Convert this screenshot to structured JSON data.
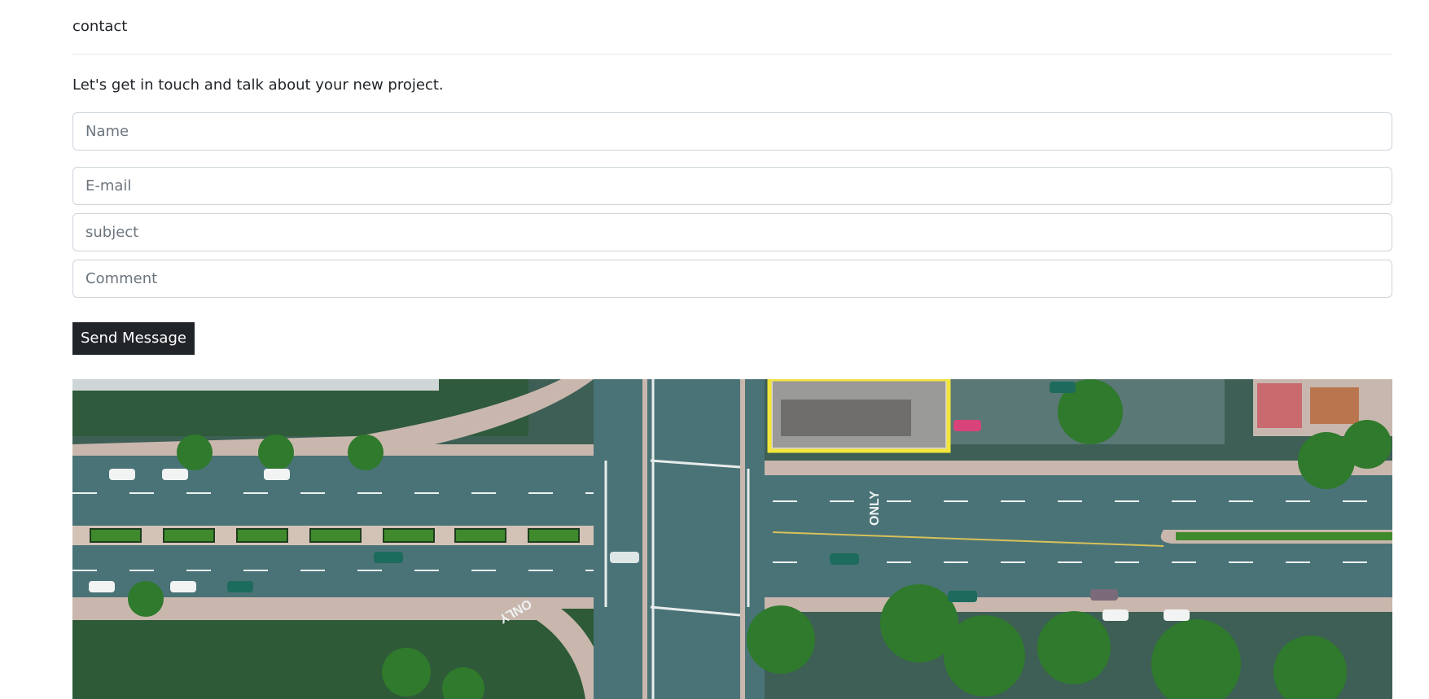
{
  "contact": {
    "heading": "contact",
    "intro": "Let's get in touch and talk about your new project.",
    "fields": {
      "name_placeholder": "Name",
      "email_placeholder": "E-mail",
      "subject_placeholder": "subject",
      "comment_placeholder": "Comment"
    },
    "send_label": "Send Message"
  },
  "image": {
    "turn_marking_right": "ONLY",
    "turn_marking_left": "ONLY"
  },
  "colors": {
    "button_bg": "#212529",
    "button_text": "#ffffff",
    "field_border": "#ced4da",
    "divider": "#e5e7ea",
    "road": "#4a7377",
    "highlight_box": "#f2e53b"
  }
}
